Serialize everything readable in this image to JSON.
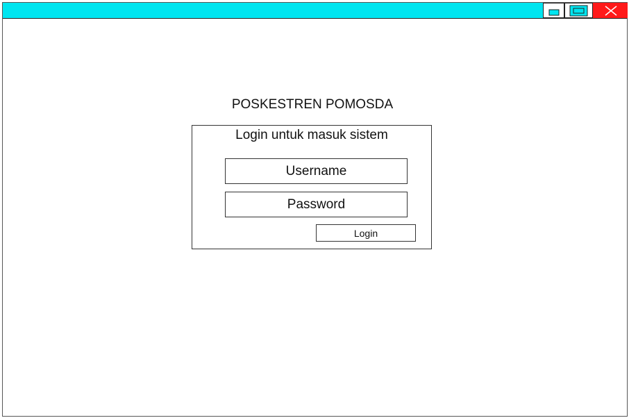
{
  "window": {
    "titlebar_color": "#00e5f0",
    "close_color": "#ff1a1a",
    "controls": {
      "minimize_icon": "minimize-icon",
      "maximize_icon": "maximize-icon",
      "close_icon": "close-icon"
    }
  },
  "app": {
    "title": "POSKESTREN POMOSDA"
  },
  "login": {
    "heading": "Login untuk masuk sistem",
    "username_placeholder": "Username",
    "password_placeholder": "Password",
    "button_label": "Login"
  }
}
